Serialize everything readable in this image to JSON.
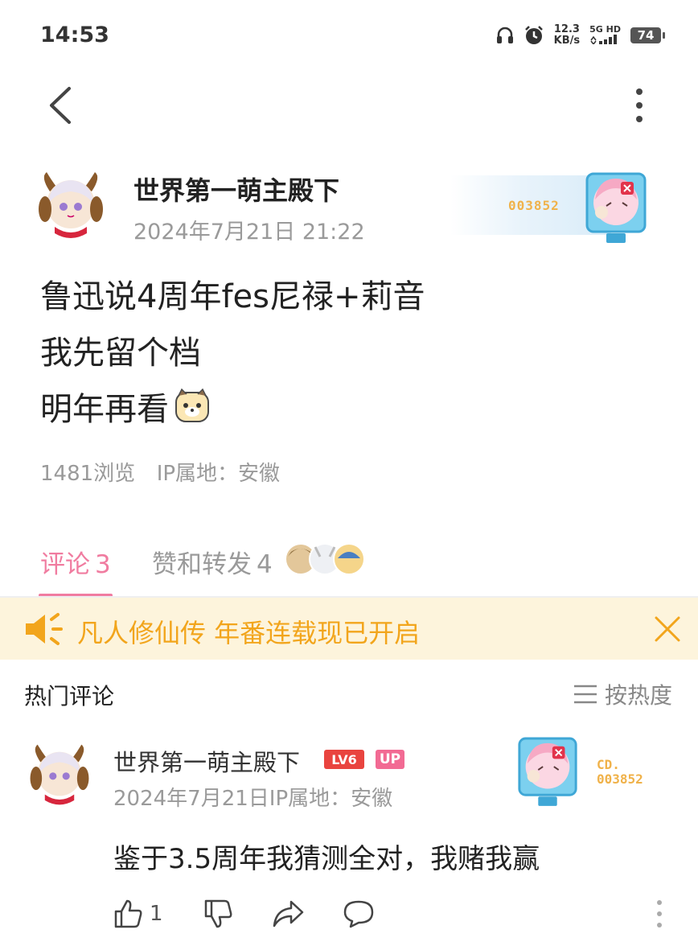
{
  "status_bar": {
    "time": "14:53",
    "net_speed_value": "12.3",
    "net_speed_unit": "KB/s",
    "signal_label": "5G HD",
    "battery": "74",
    "icons": [
      "headphones-icon",
      "alarm-icon",
      "signal-icon",
      "battery-icon"
    ]
  },
  "post": {
    "author": "世界第一萌主殿下",
    "time": "2024年7月21日 21:22",
    "badge_number": "003852",
    "lines": [
      "鲁迅说4周年fes尼禄+莉音",
      "我先留个档",
      "明年再看"
    ],
    "views": "1481浏览",
    "ip": "IP属地：安徽"
  },
  "tabs": {
    "comments_label": "评论",
    "comments_count": "3",
    "likes_label": "赞和转发",
    "likes_count": "4"
  },
  "banner": {
    "text": "凡人修仙传 年番连载现已开启"
  },
  "comments": {
    "section_title": "热门评论",
    "sort_label": "按热度",
    "items": [
      {
        "author": "世界第一萌主殿下",
        "level": "LV6",
        "up_tag": "UP",
        "time_ip": "2024年7月21日IP属地：安徽",
        "badge_line1": "CD.",
        "badge_line2": "003852",
        "text": "鉴于3.5周年我猜测全对，我赌我赢",
        "like_count": "1"
      }
    ]
  },
  "colors": {
    "accent_pink": "#f07ca0",
    "banner_bg": "#fdf4dc",
    "banner_text": "#f2a51c",
    "badge_gold": "#f0b24a"
  }
}
